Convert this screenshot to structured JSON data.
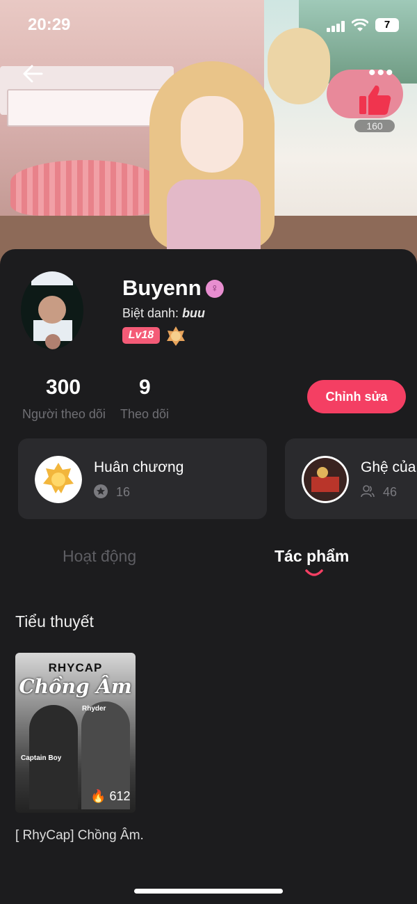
{
  "status": {
    "time": "20:29",
    "battery": "7"
  },
  "header": {
    "like_count": "160",
    "more_label": "•••"
  },
  "profile": {
    "name": "Buyenn",
    "nickname_label": "Biệt danh: ",
    "nickname": "buu",
    "level": "Lv18"
  },
  "stats": [
    {
      "value": "300",
      "label": "Người theo dõi"
    },
    {
      "value": "9",
      "label": "Theo dõi"
    }
  ],
  "edit_button": "Chỉnh sửa",
  "cards": [
    {
      "title": "Huân chương",
      "count": "16",
      "icon": "medal-icon"
    },
    {
      "title": "Ghệ của",
      "count": "46",
      "icon": "people-icon"
    }
  ],
  "tabs": [
    {
      "label": "Hoạt động",
      "active": false
    },
    {
      "label": "Tác phẩm",
      "active": true
    }
  ],
  "section_title": "Tiểu thuyết",
  "book": {
    "cover_top": "RHYCAP",
    "cover_title": "Chồng Âm",
    "cover_name_1": "Rhyder",
    "cover_name_2": "Captain Boy",
    "views": "612",
    "title": "[ RhyCap] Chồng Âm."
  },
  "colors": {
    "accent": "#f43f63",
    "background": "#1c1c1e",
    "card": "#2a2a2d"
  }
}
